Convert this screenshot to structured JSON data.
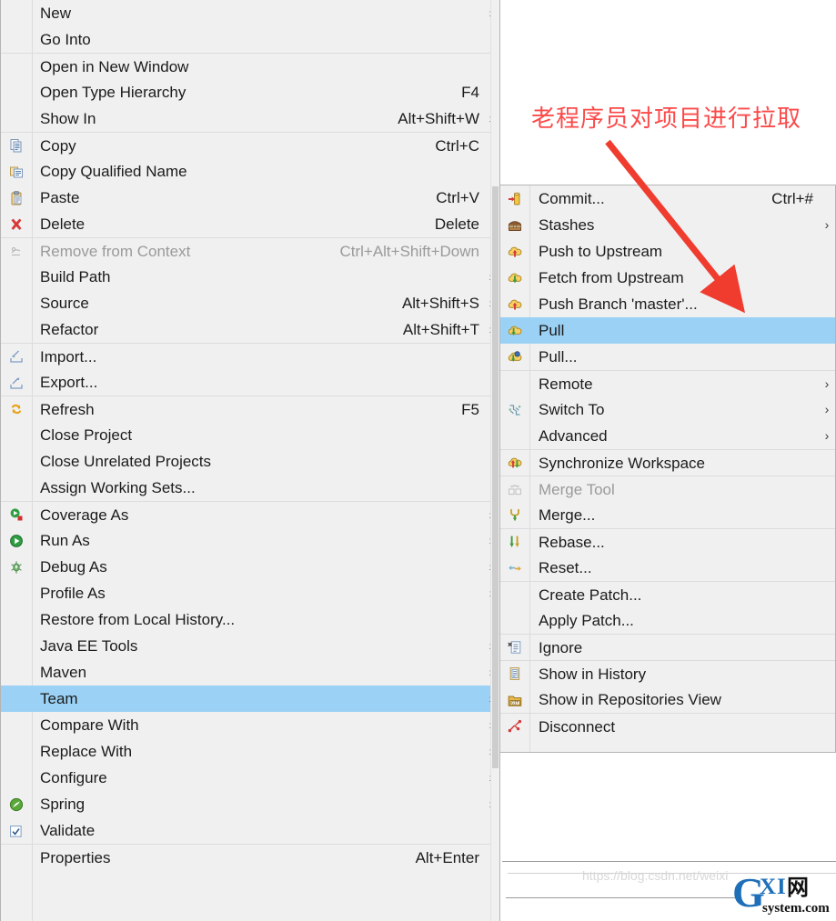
{
  "main_menu": {
    "name": "project-context-menu",
    "items": [
      {
        "label": "New",
        "accel": "",
        "arrow": true,
        "icon": "",
        "sep": false,
        "disabled": false,
        "selected": false
      },
      {
        "label": "Go Into",
        "accel": "",
        "arrow": false,
        "icon": "",
        "sep": false,
        "disabled": false,
        "selected": false
      },
      {
        "label": "Open in New Window",
        "accel": "",
        "arrow": false,
        "icon": "",
        "sep": true,
        "disabled": false,
        "selected": false
      },
      {
        "label": "Open Type Hierarchy",
        "accel": "F4",
        "arrow": false,
        "icon": "",
        "sep": false,
        "disabled": false,
        "selected": false
      },
      {
        "label": "Show In",
        "accel": "Alt+Shift+W",
        "arrow": true,
        "icon": "",
        "sep": false,
        "disabled": false,
        "selected": false
      },
      {
        "label": "Copy",
        "accel": "Ctrl+C",
        "arrow": false,
        "icon": "copy-icon",
        "sep": true,
        "disabled": false,
        "selected": false
      },
      {
        "label": "Copy Qualified Name",
        "accel": "",
        "arrow": false,
        "icon": "copy-qualified-name-icon",
        "sep": false,
        "disabled": false,
        "selected": false
      },
      {
        "label": "Paste",
        "accel": "Ctrl+V",
        "arrow": false,
        "icon": "paste-icon",
        "sep": false,
        "disabled": false,
        "selected": false
      },
      {
        "label": "Delete",
        "accel": "Delete",
        "arrow": false,
        "icon": "delete-x-icon",
        "sep": false,
        "disabled": false,
        "selected": false
      },
      {
        "label": "Remove from Context",
        "accel": "Ctrl+Alt+Shift+Down",
        "arrow": false,
        "icon": "remove-from-context-icon",
        "sep": true,
        "disabled": true,
        "selected": false
      },
      {
        "label": "Build Path",
        "accel": "",
        "arrow": true,
        "icon": "",
        "sep": false,
        "disabled": false,
        "selected": false
      },
      {
        "label": "Source",
        "accel": "Alt+Shift+S",
        "arrow": true,
        "icon": "",
        "sep": false,
        "disabled": false,
        "selected": false
      },
      {
        "label": "Refactor",
        "accel": "Alt+Shift+T",
        "arrow": true,
        "icon": "",
        "sep": false,
        "disabled": false,
        "selected": false
      },
      {
        "label": "Import...",
        "accel": "",
        "arrow": false,
        "icon": "import-icon",
        "sep": true,
        "disabled": false,
        "selected": false
      },
      {
        "label": "Export...",
        "accel": "",
        "arrow": false,
        "icon": "export-icon",
        "sep": false,
        "disabled": false,
        "selected": false
      },
      {
        "label": "Refresh",
        "accel": "F5",
        "arrow": false,
        "icon": "refresh-icon",
        "sep": true,
        "disabled": false,
        "selected": false
      },
      {
        "label": "Close Project",
        "accel": "",
        "arrow": false,
        "icon": "",
        "sep": false,
        "disabled": false,
        "selected": false
      },
      {
        "label": "Close Unrelated Projects",
        "accel": "",
        "arrow": false,
        "icon": "",
        "sep": false,
        "disabled": false,
        "selected": false
      },
      {
        "label": "Assign Working Sets...",
        "accel": "",
        "arrow": false,
        "icon": "",
        "sep": false,
        "disabled": false,
        "selected": false
      },
      {
        "label": "Coverage As",
        "accel": "",
        "arrow": true,
        "icon": "coverage-as-icon",
        "sep": true,
        "disabled": false,
        "selected": false
      },
      {
        "label": "Run As",
        "accel": "",
        "arrow": true,
        "icon": "run-as-icon",
        "sep": false,
        "disabled": false,
        "selected": false
      },
      {
        "label": "Debug As",
        "accel": "",
        "arrow": true,
        "icon": "debug-as-icon",
        "sep": false,
        "disabled": false,
        "selected": false
      },
      {
        "label": "Profile As",
        "accel": "",
        "arrow": true,
        "icon": "",
        "sep": false,
        "disabled": false,
        "selected": false
      },
      {
        "label": "Restore from Local History...",
        "accel": "",
        "arrow": false,
        "icon": "",
        "sep": false,
        "disabled": false,
        "selected": false
      },
      {
        "label": "Java EE Tools",
        "accel": "",
        "arrow": true,
        "icon": "",
        "sep": false,
        "disabled": false,
        "selected": false
      },
      {
        "label": "Maven",
        "accel": "",
        "arrow": true,
        "icon": "",
        "sep": false,
        "disabled": false,
        "selected": false
      },
      {
        "label": "Team",
        "accel": "",
        "arrow": true,
        "icon": "",
        "sep": false,
        "disabled": false,
        "selected": true
      },
      {
        "label": "Compare With",
        "accel": "",
        "arrow": true,
        "icon": "",
        "sep": false,
        "disabled": false,
        "selected": false
      },
      {
        "label": "Replace With",
        "accel": "",
        "arrow": true,
        "icon": "",
        "sep": false,
        "disabled": false,
        "selected": false
      },
      {
        "label": "Configure",
        "accel": "",
        "arrow": true,
        "icon": "",
        "sep": false,
        "disabled": false,
        "selected": false
      },
      {
        "label": "Spring",
        "accel": "",
        "arrow": true,
        "icon": "spring-leaf-icon",
        "sep": false,
        "disabled": false,
        "selected": false
      },
      {
        "label": "Validate",
        "accel": "",
        "arrow": false,
        "icon": "validate-checkbox-icon",
        "sep": false,
        "disabled": false,
        "selected": false
      },
      {
        "label": "Properties",
        "accel": "Alt+Enter",
        "arrow": false,
        "icon": "",
        "sep": true,
        "disabled": false,
        "selected": false
      }
    ]
  },
  "sub_menu": {
    "name": "team-git-submenu",
    "items": [
      {
        "label": "Commit...",
        "accel": "Ctrl+#",
        "arrow": false,
        "icon": "commit-icon",
        "sep": false,
        "disabled": false,
        "selected": false
      },
      {
        "label": "Stashes",
        "accel": "",
        "arrow": true,
        "icon": "stashes-icon",
        "sep": false,
        "disabled": false,
        "selected": false
      },
      {
        "label": "Push to Upstream",
        "accel": "",
        "arrow": false,
        "icon": "push-upstream-icon",
        "sep": false,
        "disabled": false,
        "selected": false
      },
      {
        "label": "Fetch from Upstream",
        "accel": "",
        "arrow": false,
        "icon": "fetch-upstream-icon",
        "sep": false,
        "disabled": false,
        "selected": false
      },
      {
        "label": "Push Branch 'master'...",
        "accel": "",
        "arrow": false,
        "icon": "push-branch-icon",
        "sep": false,
        "disabled": false,
        "selected": false
      },
      {
        "label": "Pull",
        "accel": "",
        "arrow": false,
        "icon": "pull-icon",
        "sep": false,
        "disabled": false,
        "selected": true
      },
      {
        "label": "Pull...",
        "accel": "",
        "arrow": false,
        "icon": "pull-config-icon",
        "sep": false,
        "disabled": false,
        "selected": false
      },
      {
        "label": "Remote",
        "accel": "",
        "arrow": true,
        "icon": "",
        "sep": true,
        "disabled": false,
        "selected": false
      },
      {
        "label": "Switch To",
        "accel": "",
        "arrow": true,
        "icon": "switch-to-icon",
        "sep": false,
        "disabled": false,
        "selected": false
      },
      {
        "label": "Advanced",
        "accel": "",
        "arrow": true,
        "icon": "",
        "sep": false,
        "disabled": false,
        "selected": false
      },
      {
        "label": "Synchronize Workspace",
        "accel": "",
        "arrow": false,
        "icon": "synchronize-icon",
        "sep": true,
        "disabled": false,
        "selected": false
      },
      {
        "label": "Merge Tool",
        "accel": "",
        "arrow": false,
        "icon": "merge-tool-icon",
        "sep": true,
        "disabled": true,
        "selected": false
      },
      {
        "label": "Merge...",
        "accel": "",
        "arrow": false,
        "icon": "merge-icon",
        "sep": false,
        "disabled": false,
        "selected": false
      },
      {
        "label": "Rebase...",
        "accel": "",
        "arrow": false,
        "icon": "rebase-icon",
        "sep": true,
        "disabled": false,
        "selected": false
      },
      {
        "label": "Reset...",
        "accel": "",
        "arrow": false,
        "icon": "reset-icon",
        "sep": false,
        "disabled": false,
        "selected": false
      },
      {
        "label": "Create Patch...",
        "accel": "",
        "arrow": false,
        "icon": "",
        "sep": true,
        "disabled": false,
        "selected": false
      },
      {
        "label": "Apply Patch...",
        "accel": "",
        "arrow": false,
        "icon": "",
        "sep": false,
        "disabled": false,
        "selected": false
      },
      {
        "label": "Ignore",
        "accel": "",
        "arrow": false,
        "icon": "ignore-icon",
        "sep": true,
        "disabled": false,
        "selected": false
      },
      {
        "label": "Show in History",
        "accel": "",
        "arrow": false,
        "icon": "show-in-history-icon",
        "sep": true,
        "disabled": false,
        "selected": false
      },
      {
        "label": "Show in Repositories View",
        "accel": "",
        "arrow": false,
        "icon": "show-in-repositories-icon",
        "sep": false,
        "disabled": false,
        "selected": false
      },
      {
        "label": "Disconnect",
        "accel": "",
        "arrow": false,
        "icon": "disconnect-icon",
        "sep": true,
        "disabled": false,
        "selected": false
      }
    ]
  },
  "annotation": {
    "text": "老程序员对项目进行拉取",
    "color": "#fb4a4a",
    "arrow_color": "#f03c2e"
  },
  "watermark": {
    "url": "https://blog.csdn.net/weixi",
    "logo_main": "G",
    "logo_x": "X",
    "logo_i": "I",
    "logo_cn": "网",
    "logo_sub": "system.com",
    "logo_color": "#1f6fb8"
  },
  "colors": {
    "menu_bg": "#f0f0f0",
    "menu_border": "#b4b4b4",
    "selection": "#9BD1F5",
    "separator": "#dcdcdc",
    "text": "#1b1b1b",
    "text_disabled": "#9a9a9a"
  }
}
